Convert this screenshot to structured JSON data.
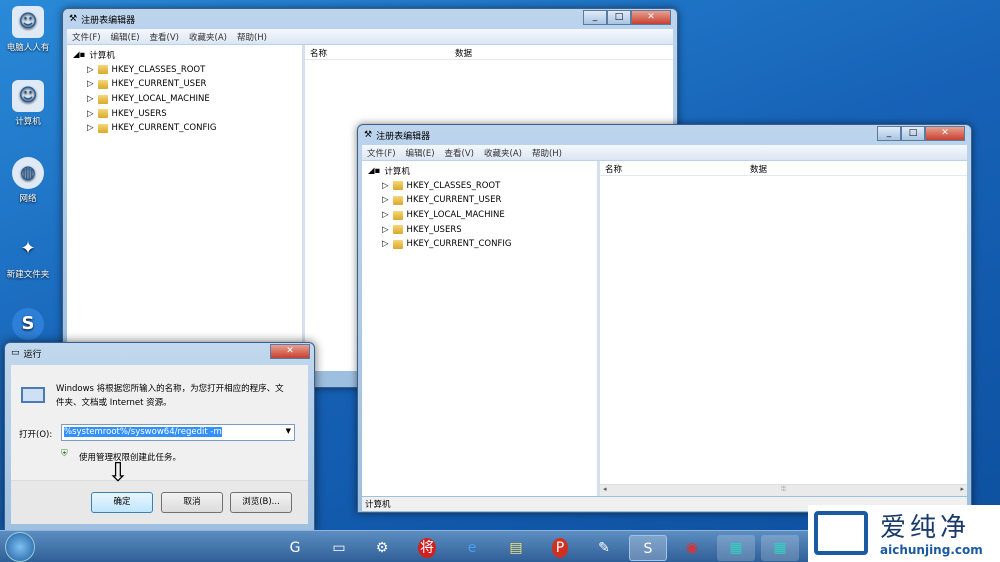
{
  "desktop": {
    "icons": [
      {
        "label": "电脑人人有",
        "glyph": "☺"
      },
      {
        "label": "计算机",
        "glyph": "☺"
      },
      {
        "label": "网络",
        "glyph": "◍"
      },
      {
        "label": "新建文件夹",
        "glyph": "✦"
      },
      {
        "label": "",
        "glyph": "S"
      }
    ]
  },
  "regedit": {
    "title": "注册表编辑器",
    "menu": [
      "文件(F)",
      "编辑(E)",
      "查看(V)",
      "收藏夹(A)",
      "帮助(H)"
    ],
    "root": "计算机",
    "keys": [
      "HKEY_CLASSES_ROOT",
      "HKEY_CURRENT_USER",
      "HKEY_LOCAL_MACHINE",
      "HKEY_USERS",
      "HKEY_CURRENT_CONFIG"
    ],
    "columns": [
      "名称",
      "数据"
    ],
    "status": "计算机"
  },
  "run": {
    "title": "运行",
    "description": "Windows 将根据您所输入的名称，为您打开相应的程序、文件夹、文档或 Internet 资源。",
    "open_label": "打开(O):",
    "command": "%systemroot%/syswow64/regedit -m",
    "admin_note": "使用管理权限创建此任务。",
    "ok": "确定",
    "cancel": "取消",
    "browse": "浏览(B)..."
  },
  "taskbar": {
    "items": [
      "G",
      "▭",
      "⚙",
      "将",
      "e",
      "▤",
      "P",
      "✎",
      "S",
      "◉",
      "▦",
      "▦"
    ]
  },
  "watermark": {
    "brand": "爱纯净",
    "url": "aichunjing.com"
  }
}
